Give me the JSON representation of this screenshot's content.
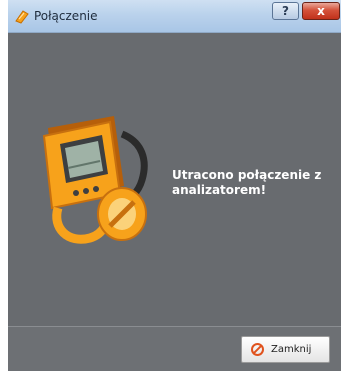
{
  "window": {
    "title": "Połączenie",
    "help_label": "?",
    "close_label": "x"
  },
  "dialog": {
    "message": "Utracono połączenie z analizatorem!",
    "illustration": "analyzer-device-icon",
    "accent_color": "#f7a21b"
  },
  "footer": {
    "close_button_label": "Zamknij",
    "close_button_icon": "no-entry-icon"
  }
}
